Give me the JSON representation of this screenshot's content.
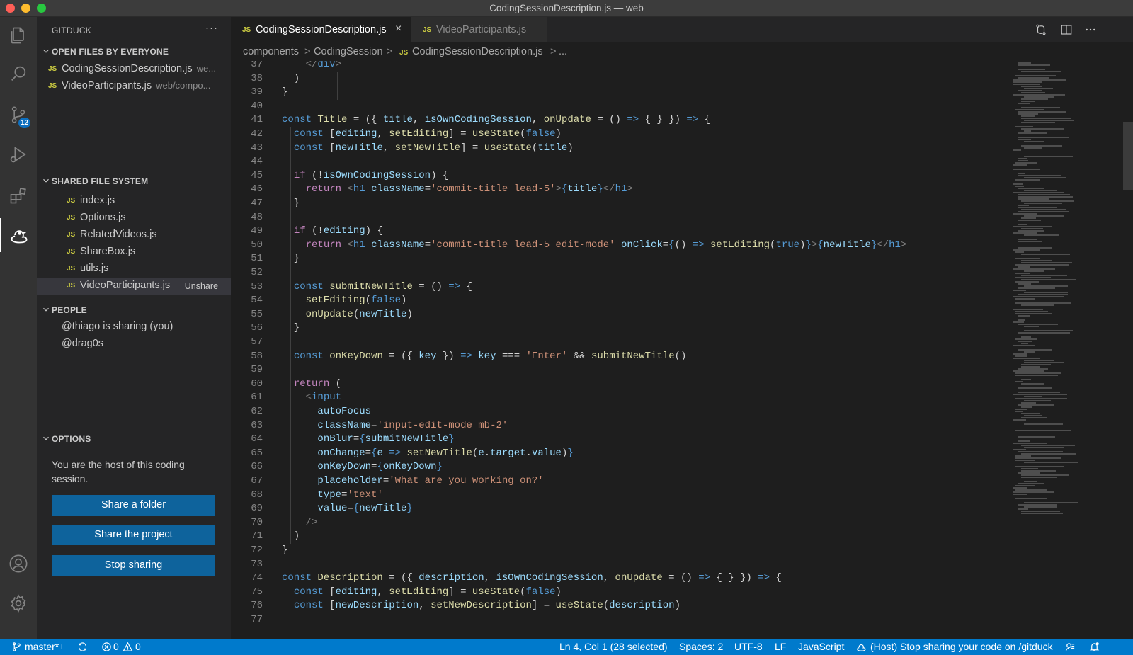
{
  "window": {
    "title": "CodingSessionDescription.js — web"
  },
  "activity_bar": {
    "items": [
      "files-icon",
      "search-icon",
      "source-control-icon",
      "run-debug-icon",
      "extensions-icon",
      "gitduck-icon",
      "account-icon",
      "settings-gear-icon"
    ],
    "source_control_badge": "12"
  },
  "sidebar": {
    "title": "GITDUCK",
    "more": "···",
    "open_files": {
      "header": "OPEN FILES BY EVERYONE",
      "files": [
        {
          "icon": "JS",
          "name": "CodingSessionDescription.js",
          "path": "we..."
        },
        {
          "icon": "JS",
          "name": "VideoParticipants.js",
          "path": "web/compo..."
        }
      ]
    },
    "shared_fs": {
      "header": "SHARED FILE SYSTEM",
      "files": [
        {
          "icon": "JS",
          "name": "index.js"
        },
        {
          "icon": "JS",
          "name": "Options.js"
        },
        {
          "icon": "JS",
          "name": "RelatedVideos.js"
        },
        {
          "icon": "JS",
          "name": "ShareBox.js"
        },
        {
          "icon": "JS",
          "name": "utils.js"
        },
        {
          "icon": "JS",
          "name": "VideoParticipants.js",
          "action": "Unshare"
        }
      ]
    },
    "people": {
      "header": "PEOPLE",
      "items": [
        "@thiago is sharing (you)",
        "@drag0s"
      ]
    },
    "options": {
      "header": "OPTIONS",
      "text": "You are the host of this coding session.",
      "buttons": [
        "Share a folder",
        "Share the project",
        "Stop sharing"
      ]
    }
  },
  "tabs": [
    {
      "icon": "JS",
      "label": "CodingSessionDescription.js",
      "active": true,
      "close": "×"
    },
    {
      "icon": "JS",
      "label": "VideoParticipants.js",
      "active": false
    }
  ],
  "breadcrumb": [
    "components",
    "CodingSession",
    "CodingSessionDescription.js",
    "..."
  ],
  "editor": {
    "lines": [
      {
        "n": "37",
        "html": "    <span class=\"p\">&lt;/</span><span class=\"t\">div</span><span class=\"p\">&gt;</span>"
      },
      {
        "n": "38",
        "html": "  )"
      },
      {
        "n": "39",
        "html": "}"
      },
      {
        "n": "40",
        "html": ""
      },
      {
        "n": "41",
        "html": "<span class=\"k\">const</span> <span class=\"f\">Title</span> = ({ <span class=\"v\">title</span>, <span class=\"v\">isOwnCodingSession</span>, <span class=\"f\">onUpdate</span> = () <span class=\"k\">=&gt;</span> { } }) <span class=\"k\">=&gt;</span> {"
      },
      {
        "n": "42",
        "html": "  <span class=\"k\">const</span> [<span class=\"v\">editing</span>, <span class=\"f\">setEditing</span>] = <span class=\"f\">useState</span>(<span class=\"k\">false</span>)"
      },
      {
        "n": "43",
        "html": "  <span class=\"k\">const</span> [<span class=\"v\">newTitle</span>, <span class=\"f\">setNewTitle</span>] = <span class=\"f\">useState</span>(<span class=\"v\">title</span>)"
      },
      {
        "n": "44",
        "html": ""
      },
      {
        "n": "45",
        "html": "  <span class=\"kc\">if</span> (!<span class=\"v\">isOwnCodingSession</span>) {"
      },
      {
        "n": "46",
        "html": "    <span class=\"kc\">return</span> <span class=\"p\">&lt;</span><span class=\"t\">h1</span> <span class=\"v\">className</span>=<span class=\"s\">'commit-title lead-5'</span><span class=\"p\">&gt;</span><span class=\"k\">{</span><span class=\"v\">title</span><span class=\"k\">}</span><span class=\"p\">&lt;/</span><span class=\"t\">h1</span><span class=\"p\">&gt;</span>"
      },
      {
        "n": "47",
        "html": "  }"
      },
      {
        "n": "48",
        "html": ""
      },
      {
        "n": "49",
        "html": "  <span class=\"kc\">if</span> (!<span class=\"v\">editing</span>) {"
      },
      {
        "n": "50",
        "html": "    <span class=\"kc\">return</span> <span class=\"p\">&lt;</span><span class=\"t\">h1</span> <span class=\"v\">className</span>=<span class=\"s\">'commit-title lead-5 edit-mode'</span> <span class=\"v\">onClick</span>=<span class=\"k\">{</span>() <span class=\"k\">=&gt;</span> <span class=\"f\">setEditing</span>(<span class=\"k\">true</span>)<span class=\"k\">}</span><span class=\"p\">&gt;</span><span class=\"k\">{</span><span class=\"v\">newTitle</span><span class=\"k\">}</span><span class=\"p\">&lt;/</span><span class=\"t\">h1</span><span class=\"p\">&gt;</span>"
      },
      {
        "n": "51",
        "html": "  }"
      },
      {
        "n": "52",
        "html": ""
      },
      {
        "n": "53",
        "html": "  <span class=\"k\">const</span> <span class=\"f\">submitNewTitle</span> = () <span class=\"k\">=&gt;</span> {"
      },
      {
        "n": "54",
        "html": "    <span class=\"f\">setEditing</span>(<span class=\"k\">false</span>)"
      },
      {
        "n": "55",
        "html": "    <span class=\"f\">onUpdate</span>(<span class=\"v\">newTitle</span>)"
      },
      {
        "n": "56",
        "html": "  }"
      },
      {
        "n": "57",
        "html": ""
      },
      {
        "n": "58",
        "html": "  <span class=\"k\">const</span> <span class=\"f\">onKeyDown</span> = ({ <span class=\"v\">key</span> }) <span class=\"k\">=&gt;</span> <span class=\"v\">key</span> === <span class=\"s\">'Enter'</span> &amp;&amp; <span class=\"f\">submitNewTitle</span>()"
      },
      {
        "n": "59",
        "html": ""
      },
      {
        "n": "60",
        "html": "  <span class=\"kc\">return</span> ("
      },
      {
        "n": "61",
        "html": "    <span class=\"p\">&lt;</span><span class=\"t\">input</span>"
      },
      {
        "n": "62",
        "html": "      <span class=\"v\">autoFocus</span>"
      },
      {
        "n": "63",
        "html": "      <span class=\"v\">className</span>=<span class=\"s\">'input-edit-mode mb-2'</span>"
      },
      {
        "n": "64",
        "html": "      <span class=\"v\">onBlur</span>=<span class=\"k\">{</span><span class=\"v\">submitNewTitle</span><span class=\"k\">}</span>"
      },
      {
        "n": "65",
        "html": "      <span class=\"v\">onChange</span>=<span class=\"k\">{</span><span class=\"v\">e</span> <span class=\"k\">=&gt;</span> <span class=\"f\">setNewTitle</span>(<span class=\"v\">e</span>.<span class=\"v\">target</span>.<span class=\"v\">value</span>)<span class=\"k\">}</span>"
      },
      {
        "n": "66",
        "html": "      <span class=\"v\">onKeyDown</span>=<span class=\"k\">{</span><span class=\"v\">onKeyDown</span><span class=\"k\">}</span>"
      },
      {
        "n": "67",
        "html": "      <span class=\"v\">placeholder</span>=<span class=\"s\">'What are you working on?'</span>"
      },
      {
        "n": "68",
        "html": "      <span class=\"v\">type</span>=<span class=\"s\">'text'</span>"
      },
      {
        "n": "69",
        "html": "      <span class=\"v\">value</span>=<span class=\"k\">{</span><span class=\"v\">newTitle</span><span class=\"k\">}</span>"
      },
      {
        "n": "70",
        "html": "    <span class=\"p\">/&gt;</span>"
      },
      {
        "n": "71",
        "html": "  )"
      },
      {
        "n": "72",
        "html": "}"
      },
      {
        "n": "73",
        "html": ""
      },
      {
        "n": "74",
        "html": "<span class=\"k\">const</span> <span class=\"f\">Description</span> = ({ <span class=\"v\">description</span>, <span class=\"v\">isOwnCodingSession</span>, <span class=\"f\">onUpdate</span> = () <span class=\"k\">=&gt;</span> { } }) <span class=\"k\">=&gt;</span> {"
      },
      {
        "n": "75",
        "html": "  <span class=\"k\">const</span> [<span class=\"v\">editing</span>, <span class=\"f\">setEditing</span>] = <span class=\"f\">useState</span>(<span class=\"k\">false</span>)"
      },
      {
        "n": "76",
        "html": "  <span class=\"k\">const</span> [<span class=\"v\">newDescription</span>, <span class=\"f\">setNewDescription</span>] = <span class=\"f\">useState</span>(<span class=\"v\">description</span>)"
      },
      {
        "n": "77",
        "html": ""
      }
    ]
  },
  "status_bar": {
    "branch": "master*+",
    "errors": "0",
    "warnings": "0",
    "cursor": "Ln 4, Col 1 (28 selected)",
    "spaces": "Spaces: 2",
    "encoding": "UTF-8",
    "eol": "LF",
    "language": "JavaScript",
    "gitduck": "(Host) Stop sharing your code on /gitduck"
  },
  "colors": {
    "accent": "#007acc",
    "button": "#0e639c",
    "editor_bg": "#1e1e1e",
    "sidebar_bg": "#252526"
  }
}
